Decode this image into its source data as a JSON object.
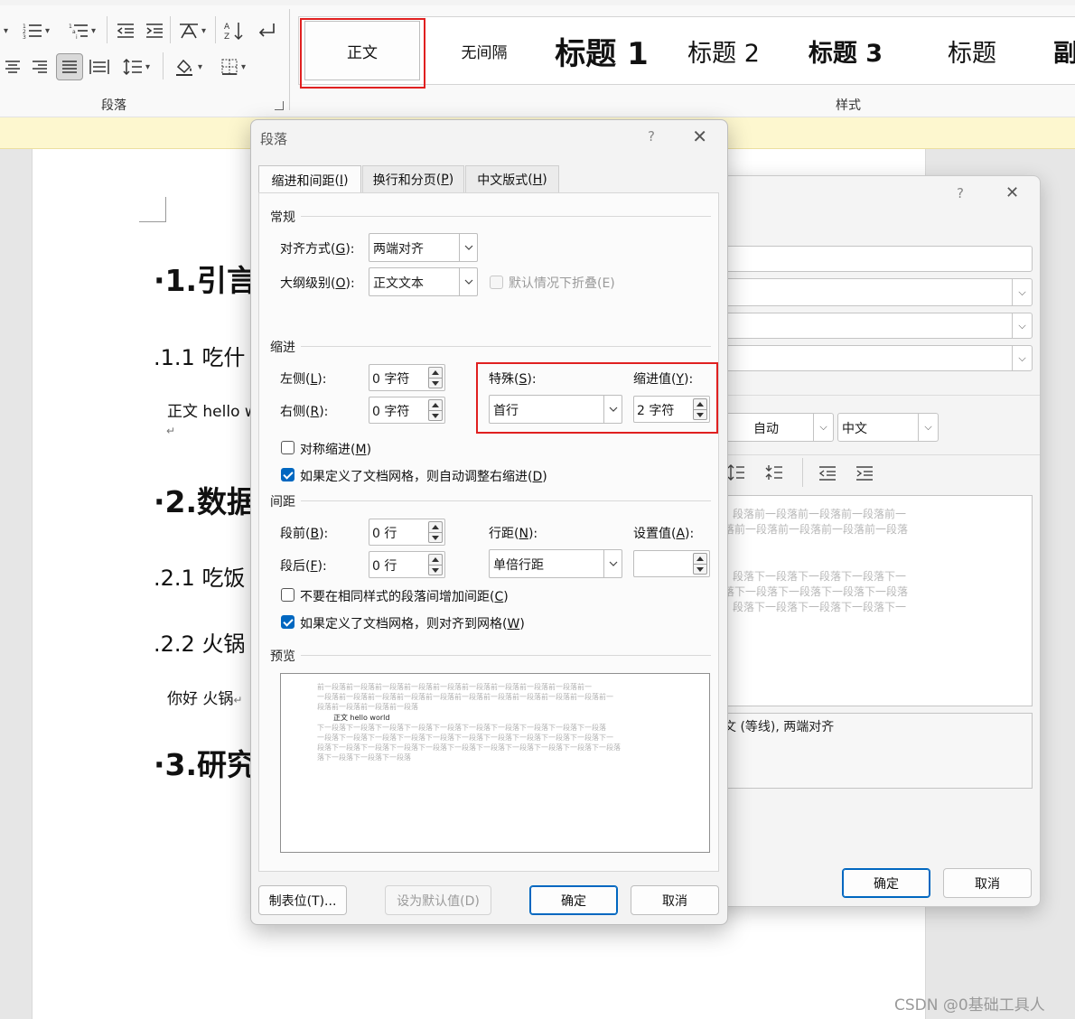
{
  "ribbon": {
    "paragraph_group_label": "段落",
    "styles_group_label": "样式",
    "styles": [
      "正文",
      "无间隔",
      "标题 1",
      "标题 2",
      "标题 3",
      "标题",
      "副"
    ]
  },
  "document": {
    "lines": [
      {
        "text": "1.引言",
        "kind": "h1",
        "bullet": "·"
      },
      {
        "text": "1.1  吃什",
        "kind": "h2",
        "bullet": "."
      },
      {
        "text": "正文  hello w",
        "kind": "body"
      },
      {
        "text": "2.数据",
        "kind": "h1",
        "bullet": "·"
      },
      {
        "text": "2.1 吃饭",
        "kind": "h2",
        "bullet": "."
      },
      {
        "text": "2.2 火锅",
        "kind": "h2",
        "bullet": "."
      },
      {
        "text": "你好  火锅",
        "kind": "body"
      },
      {
        "text": "3.研究",
        "kind": "h1",
        "bullet": "·"
      }
    ],
    "return_mark": "↵"
  },
  "paragraph_dialog": {
    "title": "段落",
    "help": "?",
    "close": "✕",
    "tabs": [
      {
        "label": "缩进和间距",
        "key": "I"
      },
      {
        "label": "换行和分页",
        "key": "P"
      },
      {
        "label": "中文版式",
        "key": "H"
      }
    ],
    "general": {
      "heading": "常规",
      "alignment_label": "对齐方式",
      "alignment_key": "G",
      "alignment_value": "两端对齐",
      "outline_label": "大纲级别",
      "outline_key": "O",
      "outline_value": "正文文本",
      "collapse_label": "默认情况下折叠(E)",
      "collapse_checked": false
    },
    "indent": {
      "heading": "缩进",
      "left_label": "左侧",
      "left_key": "L",
      "left_value": "0 字符",
      "right_label": "右侧",
      "right_key": "R",
      "right_value": "0 字符",
      "special_label": "特殊",
      "special_key": "S",
      "special_value": "首行",
      "by_label": "缩进值",
      "by_key": "Y",
      "by_value": "2 字符",
      "mirror_label": "对称缩进",
      "mirror_key": "M",
      "mirror_checked": false,
      "auto_right_label": "如果定义了文档网格，则自动调整右缩进",
      "auto_right_key": "D",
      "auto_right_checked": true
    },
    "spacing": {
      "heading": "间距",
      "before_label": "段前",
      "before_key": "B",
      "before_value": "0 行",
      "after_label": "段后",
      "after_key": "F",
      "after_value": "0 行",
      "line_label": "行距",
      "line_key": "N",
      "line_value": "单倍行距",
      "at_label": "设置值",
      "at_key": "A",
      "at_value": "",
      "no_space_label": "不要在相同样式的段落间增加间距",
      "no_space_key": "C",
      "no_space_checked": false,
      "snap_label": "如果定义了文档网格，则对齐到网格",
      "snap_key": "W",
      "snap_checked": true
    },
    "preview": {
      "heading": "预览",
      "before_lines": [
        "前一段落前一段落前一段落前一段落前一段落前一段落前一段落前一段落前一段落前一",
        "一段落前一段落前一段落前一段落前一段落前一段落前一段落前一段落前一段落前一段落前一",
        "段落前一段落前一段落前一段落"
      ],
      "sample": "正文  hello world",
      "after_lines": [
        "下一段落下一段落下一段落下一段落下一段落下一段落下一段落下一段落下一段落下一段落",
        "一段落下一段落下一段落下一段落下一段落下一段落下一段落下一段落下一段落下一段落下一",
        "段落下一段落下一段落下一段落下一段落下一段落下一段落下一段落下一段落下一段落下一段落",
        "落下一段落下一段落下一段落"
      ]
    },
    "buttons": {
      "tabs": "制表位(T)...",
      "default": "设为默认值(D)",
      "ok": "确定",
      "cancel": "取消"
    }
  },
  "background_dialog": {
    "help": "?",
    "close": "✕",
    "color_value": "自动",
    "lang_value": "中文",
    "preview_before": [
      "段落前一段落前一段落前一段落前一",
      "落前一段落前一段落前一段落前一段落"
    ],
    "preview_after": [
      "段落下一段落下一段落下一段落下一",
      "落下一段落下一段落下一段落下一段落",
      "段落下一段落下一段落下一段落下一"
    ],
    "description": "文 (等线), 两端对齐",
    "ok": "确定",
    "cancel": "取消"
  },
  "watermark": "CSDN @0基础工具人",
  "colors": {
    "highlight_red": "#e02020",
    "accent_blue": "#0067c0",
    "notice_yellow": "#fdf7cf"
  }
}
